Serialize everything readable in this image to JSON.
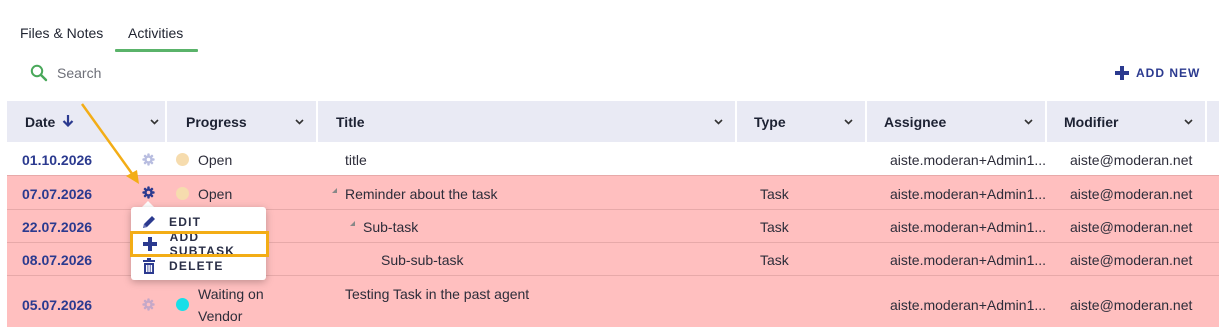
{
  "tabs": [
    {
      "label": "Files & Notes"
    },
    {
      "label": "Activities"
    }
  ],
  "search": {
    "placeholder": "Search"
  },
  "add_new": {
    "label": "ADD NEW"
  },
  "columns": {
    "date": "Date",
    "progress": "Progress",
    "title": "Title",
    "type": "Type",
    "assignee": "Assignee",
    "modifier": "Modifier"
  },
  "rows": [
    {
      "date": "01.10.2026",
      "progress": "Open",
      "title": "title",
      "type": "",
      "assignee": "aiste.moderan+Admin1...",
      "modifier": "aiste@moderan.net"
    },
    {
      "date": "07.07.2026",
      "progress": "Open",
      "title": "Reminder about the task",
      "type": "Task",
      "assignee": "aiste.moderan+Admin1...",
      "modifier": "aiste@moderan.net"
    },
    {
      "date": "22.07.2026",
      "progress": "",
      "title": "Sub-task",
      "type": "Task",
      "assignee": "aiste.moderan+Admin1...",
      "modifier": "aiste@moderan.net"
    },
    {
      "date": "08.07.2026",
      "progress": "",
      "title": "Sub-sub-task",
      "type": "Task",
      "assignee": "aiste.moderan+Admin1...",
      "modifier": "aiste@moderan.net"
    },
    {
      "date": "05.07.2026",
      "progress_line1": "Waiting on",
      "progress_line2": "Vendor",
      "title": "Testing Task in the past agent",
      "type": "",
      "assignee": "aiste.moderan+Admin1...",
      "modifier": "aiste@moderan.net"
    }
  ],
  "context_menu": {
    "edit": "EDIT",
    "add_subtask": "ADD SUBTASK",
    "delete": "DELETE"
  },
  "colors": {
    "accent": "#2b3a8f",
    "tab_underline": "#5ab36a",
    "row_highlight": "#ffbfbf",
    "header_bg": "#e9eaf4",
    "open_status": "#f6dcae",
    "waiting_status": "#17dfe8",
    "annotation": "#f3ad16"
  },
  "icons": {
    "search": "search-icon",
    "add": "plus-icon",
    "sort": "arrow-down-icon",
    "row_menu": "gear-icon",
    "edit": "pencil-icon",
    "delete": "trash-icon"
  }
}
